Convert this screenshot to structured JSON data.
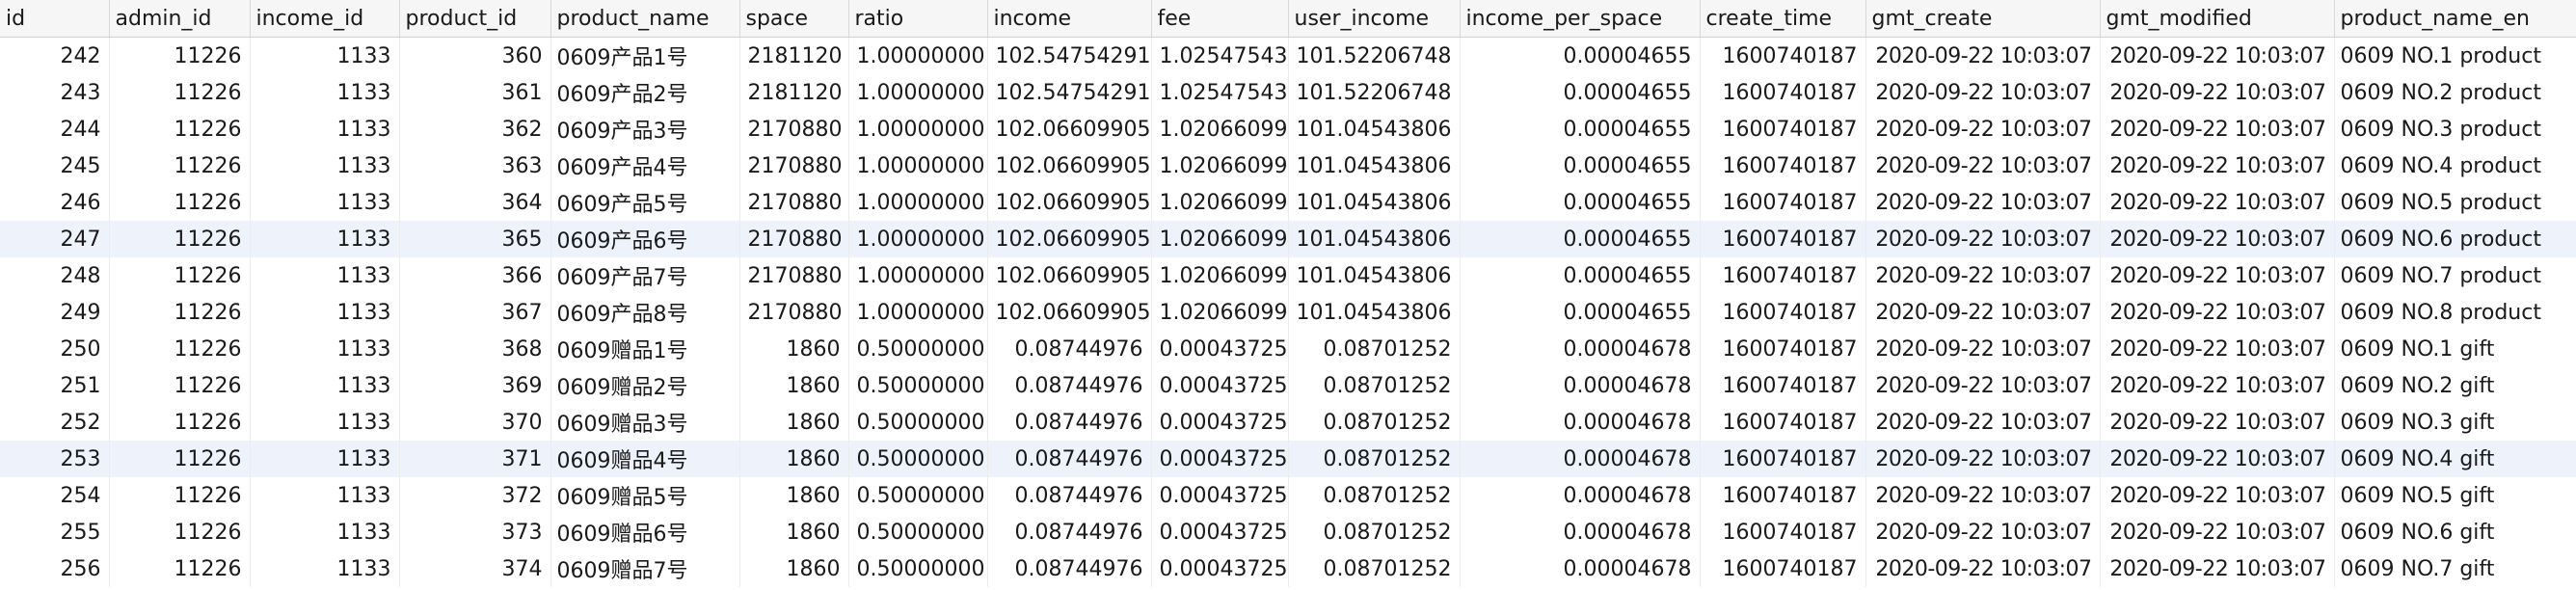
{
  "columns": [
    {
      "label": "id",
      "align": "num"
    },
    {
      "label": "admin_id",
      "align": "num"
    },
    {
      "label": "income_id",
      "align": "num"
    },
    {
      "label": "product_id",
      "align": "num"
    },
    {
      "label": "product_name",
      "align": "txt"
    },
    {
      "label": "space",
      "align": "num"
    },
    {
      "label": "ratio",
      "align": "num"
    },
    {
      "label": "income",
      "align": "num"
    },
    {
      "label": "fee",
      "align": "num"
    },
    {
      "label": "user_income",
      "align": "num"
    },
    {
      "label": "income_per_space",
      "align": "num"
    },
    {
      "label": "create_time",
      "align": "num"
    },
    {
      "label": "gmt_create",
      "align": "num"
    },
    {
      "label": "gmt_modified",
      "align": "num"
    },
    {
      "label": "product_name_en",
      "align": "txt"
    }
  ],
  "selected_row_ids": [
    "247",
    "253"
  ],
  "rows": [
    [
      "242",
      "11226",
      "1133",
      "360",
      "0609产品1号",
      "2181120",
      "1.00000000",
      "102.54754291",
      "1.02547543",
      "101.52206748",
      "0.00004655",
      "1600740187",
      "2020-09-22 10:03:07",
      "2020-09-22 10:03:07",
      "0609 NO.1 product"
    ],
    [
      "243",
      "11226",
      "1133",
      "361",
      "0609产品2号",
      "2181120",
      "1.00000000",
      "102.54754291",
      "1.02547543",
      "101.52206748",
      "0.00004655",
      "1600740187",
      "2020-09-22 10:03:07",
      "2020-09-22 10:03:07",
      "0609 NO.2 product"
    ],
    [
      "244",
      "11226",
      "1133",
      "362",
      "0609产品3号",
      "2170880",
      "1.00000000",
      "102.06609905",
      "1.02066099",
      "101.04543806",
      "0.00004655",
      "1600740187",
      "2020-09-22 10:03:07",
      "2020-09-22 10:03:07",
      "0609 NO.3 product"
    ],
    [
      "245",
      "11226",
      "1133",
      "363",
      "0609产品4号",
      "2170880",
      "1.00000000",
      "102.06609905",
      "1.02066099",
      "101.04543806",
      "0.00004655",
      "1600740187",
      "2020-09-22 10:03:07",
      "2020-09-22 10:03:07",
      "0609 NO.4 product"
    ],
    [
      "246",
      "11226",
      "1133",
      "364",
      "0609产品5号",
      "2170880",
      "1.00000000",
      "102.06609905",
      "1.02066099",
      "101.04543806",
      "0.00004655",
      "1600740187",
      "2020-09-22 10:03:07",
      "2020-09-22 10:03:07",
      "0609 NO.5 product"
    ],
    [
      "247",
      "11226",
      "1133",
      "365",
      "0609产品6号",
      "2170880",
      "1.00000000",
      "102.06609905",
      "1.02066099",
      "101.04543806",
      "0.00004655",
      "1600740187",
      "2020-09-22 10:03:07",
      "2020-09-22 10:03:07",
      "0609 NO.6 product"
    ],
    [
      "248",
      "11226",
      "1133",
      "366",
      "0609产品7号",
      "2170880",
      "1.00000000",
      "102.06609905",
      "1.02066099",
      "101.04543806",
      "0.00004655",
      "1600740187",
      "2020-09-22 10:03:07",
      "2020-09-22 10:03:07",
      "0609 NO.7 product"
    ],
    [
      "249",
      "11226",
      "1133",
      "367",
      "0609产品8号",
      "2170880",
      "1.00000000",
      "102.06609905",
      "1.02066099",
      "101.04543806",
      "0.00004655",
      "1600740187",
      "2020-09-22 10:03:07",
      "2020-09-22 10:03:07",
      "0609 NO.8 product"
    ],
    [
      "250",
      "11226",
      "1133",
      "368",
      "0609赠品1号",
      "1860",
      "0.50000000",
      "0.08744976",
      "0.00043725",
      "0.08701252",
      "0.00004678",
      "1600740187",
      "2020-09-22 10:03:07",
      "2020-09-22 10:03:07",
      "0609 NO.1 gift"
    ],
    [
      "251",
      "11226",
      "1133",
      "369",
      "0609赠品2号",
      "1860",
      "0.50000000",
      "0.08744976",
      "0.00043725",
      "0.08701252",
      "0.00004678",
      "1600740187",
      "2020-09-22 10:03:07",
      "2020-09-22 10:03:07",
      "0609 NO.2 gift"
    ],
    [
      "252",
      "11226",
      "1133",
      "370",
      "0609赠品3号",
      "1860",
      "0.50000000",
      "0.08744976",
      "0.00043725",
      "0.08701252",
      "0.00004678",
      "1600740187",
      "2020-09-22 10:03:07",
      "2020-09-22 10:03:07",
      "0609 NO.3 gift"
    ],
    [
      "253",
      "11226",
      "1133",
      "371",
      "0609赠品4号",
      "1860",
      "0.50000000",
      "0.08744976",
      "0.00043725",
      "0.08701252",
      "0.00004678",
      "1600740187",
      "2020-09-22 10:03:07",
      "2020-09-22 10:03:07",
      "0609 NO.4 gift"
    ],
    [
      "254",
      "11226",
      "1133",
      "372",
      "0609赠品5号",
      "1860",
      "0.50000000",
      "0.08744976",
      "0.00043725",
      "0.08701252",
      "0.00004678",
      "1600740187",
      "2020-09-22 10:03:07",
      "2020-09-22 10:03:07",
      "0609 NO.5 gift"
    ],
    [
      "255",
      "11226",
      "1133",
      "373",
      "0609赠品6号",
      "1860",
      "0.50000000",
      "0.08744976",
      "0.00043725",
      "0.08701252",
      "0.00004678",
      "1600740187",
      "2020-09-22 10:03:07",
      "2020-09-22 10:03:07",
      "0609 NO.6 gift"
    ],
    [
      "256",
      "11226",
      "1133",
      "374",
      "0609赠品7号",
      "1860",
      "0.50000000",
      "0.08744976",
      "0.00043725",
      "0.08701252",
      "0.00004678",
      "1600740187",
      "2020-09-22 10:03:07",
      "2020-09-22 10:03:07",
      "0609 NO.7 gift"
    ]
  ]
}
